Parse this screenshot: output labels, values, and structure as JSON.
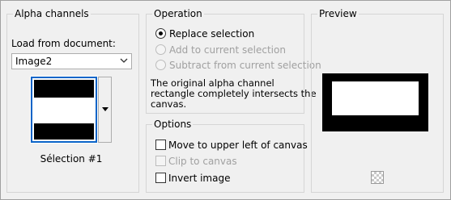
{
  "alpha_channels": {
    "title": "Alpha channels",
    "load_from_label": "Load from document:",
    "load_from_mnemonic": "d",
    "document_select_value": "Image2",
    "selection_caption": "Sélection #1"
  },
  "operation": {
    "title": "Operation",
    "options": [
      {
        "label": "Replace selection",
        "checked": true,
        "enabled": true
      },
      {
        "label": "Add to current selection",
        "checked": false,
        "enabled": false
      },
      {
        "label": "Subtract from current selection",
        "checked": false,
        "enabled": false
      }
    ],
    "description_line1": "The original alpha channel",
    "description_line2": "rectangle completely intersects the",
    "description_line3": "canvas."
  },
  "options": {
    "title": "Options",
    "items": [
      {
        "label": "Move to upper left of canvas",
        "checked": false,
        "enabled": true
      },
      {
        "label": "Clip to canvas",
        "checked": false,
        "enabled": false
      },
      {
        "label": "Invert image",
        "checked": false,
        "enabled": true
      }
    ]
  },
  "preview": {
    "title": "Preview"
  },
  "colors": {
    "thumb_selected_border": "#0a64c8",
    "background": "#f0f0f0"
  }
}
